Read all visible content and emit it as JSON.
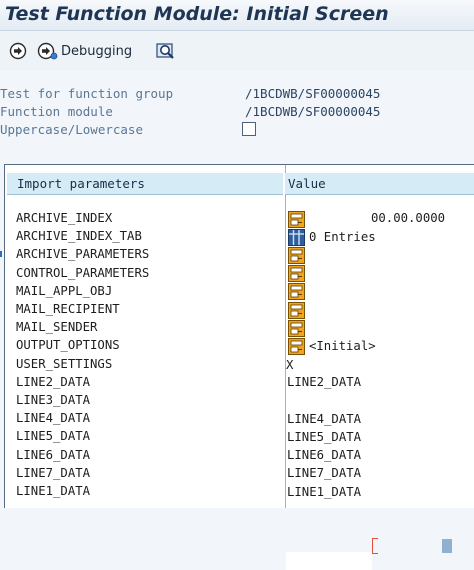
{
  "window": {
    "title": "Test Function Module: Initial Screen"
  },
  "toolbar": {
    "execute_icon": "execute-icon",
    "debugging_icon": "debug-icon",
    "debugging_label": "Debugging",
    "test_data_icon": "test-data-directory-icon"
  },
  "info": {
    "group_label": "Test for function group",
    "group_value": "/1BCDWB/SF00000045",
    "module_label": "Function module",
    "module_value": "/1BCDWB/SF00000045",
    "case_label": "Uppercase/Lowercase",
    "case_checked": false
  },
  "table": {
    "col_import": "Import parameters",
    "col_value": "Value",
    "rows": [
      {
        "name": "ARCHIVE_INDEX",
        "icon": "structure-icon",
        "value": "00.00.0000"
      },
      {
        "name": "ARCHIVE_INDEX_TAB",
        "icon": "table-icon",
        "value": "0 Entries"
      },
      {
        "name": "ARCHIVE_PARAMETERS",
        "icon": "structure-icon",
        "value": ""
      },
      {
        "name": "CONTROL_PARAMETERS",
        "icon": "structure-icon",
        "value": ""
      },
      {
        "name": "MAIL_APPL_OBJ",
        "icon": "structure-icon",
        "value": ""
      },
      {
        "name": "MAIL_RECIPIENT",
        "icon": "structure-icon",
        "value": ""
      },
      {
        "name": "MAIL_SENDER",
        "icon": "structure-icon",
        "value": ""
      },
      {
        "name": "OUTPUT_OPTIONS",
        "icon": "structure-icon",
        "value": "<Initial>"
      },
      {
        "name": "USER_SETTINGS",
        "icon": "",
        "value": "X"
      },
      {
        "name": "LINE2_DATA",
        "icon": "",
        "value": "LINE2_DATA"
      },
      {
        "name": "LINE3_DATA",
        "icon": "",
        "value": ""
      },
      {
        "name": "LINE4_DATA",
        "icon": "",
        "value": "LINE4_DATA"
      },
      {
        "name": "LINE5_DATA",
        "icon": "",
        "value": "LINE5_DATA"
      },
      {
        "name": "LINE6_DATA",
        "icon": "",
        "value": "LINE6_DATA"
      },
      {
        "name": "LINE7_DATA",
        "icon": "",
        "value": "LINE7_DATA"
      },
      {
        "name": "LINE1_DATA",
        "icon": "",
        "value": "LINE1_DATA"
      }
    ]
  },
  "colors": {
    "title": "#1e3553",
    "header_bg": "#d5ecf6",
    "info_label": "#5b7793",
    "icon_orange": "#f0a420"
  }
}
